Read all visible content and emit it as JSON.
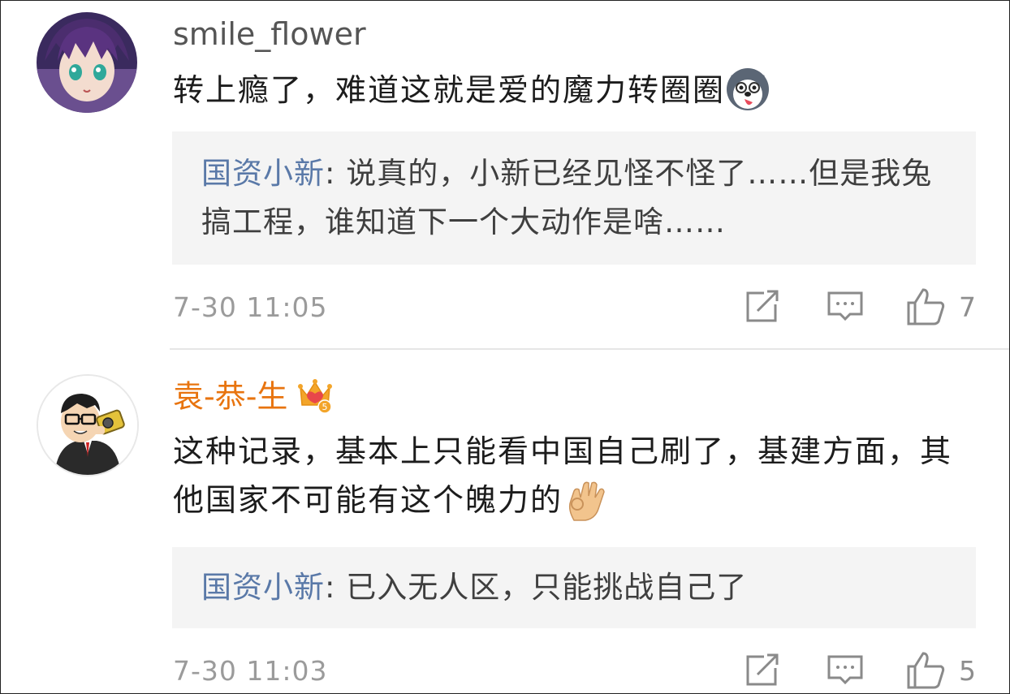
{
  "comments": [
    {
      "username": "smile_flower",
      "text": "转上瘾了，难道这就是爱的魔力转圈圈",
      "emoji": "husky-dog-emoji",
      "reply": {
        "author": "国资小新",
        "separator": ":",
        "text": " 说真的，小新已经见怪不怪了……但是我兔搞工程，谁知道下一个大动作是啥……"
      },
      "timestamp": "7-30 11:05",
      "likes": "7"
    },
    {
      "username": "袁-恭-生",
      "badge": "crown-level-5-icon",
      "badge_level": "5",
      "text": "这种记录，基本上只能看中国自己刷了，基建方面，其他国家不可能有这个魄力的",
      "emoji": "ok-hand-emoji",
      "reply": {
        "author": "国资小新",
        "separator": ":",
        "text": " 已入无人区，只能挑战自己了"
      },
      "timestamp": "7-30 11:03",
      "likes": "5"
    }
  ],
  "colors": {
    "username_default": "#555555",
    "username_vip": "#e8740f",
    "reply_author": "#5a79a8",
    "reply_bg": "#f4f4f4",
    "meta": "#9b9b9b"
  }
}
